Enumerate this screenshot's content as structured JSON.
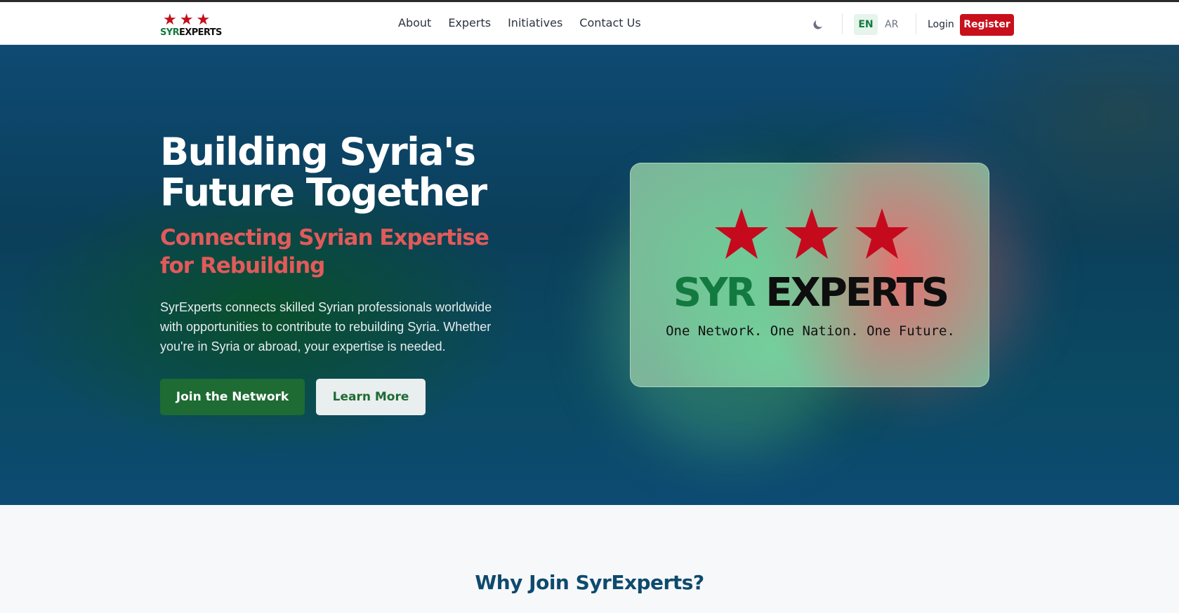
{
  "brand": {
    "logo_left": "SYR",
    "logo_right": "EXPERTS"
  },
  "nav": {
    "items": [
      {
        "label": "About"
      },
      {
        "label": "Experts"
      },
      {
        "label": "Initiatives"
      },
      {
        "label": "Contact Us"
      }
    ],
    "lang_en": "EN",
    "lang_ar": "AR",
    "login": "Login",
    "register": "Register"
  },
  "hero": {
    "title": "Building Syria's Future Together",
    "subtitle": "Connecting Syrian Expertise for Rebuilding",
    "description": "SyrExperts connects skilled Syrian professionals worldwide with opportunities to contribute to rebuilding Syria. Whether you're in Syria or abroad, your expertise is needed.",
    "primary_button": "Join the Network",
    "secondary_button": "Learn More",
    "card_brand_left": "SYR",
    "card_brand_right": "EXPERTS",
    "card_tagline": "One Network. One Nation. One Future."
  },
  "section": {
    "title": "Why Join SyrExperts?"
  },
  "colors": {
    "green": "#1e6b34",
    "red": "#c8101c",
    "navy": "#0e4a6e"
  }
}
